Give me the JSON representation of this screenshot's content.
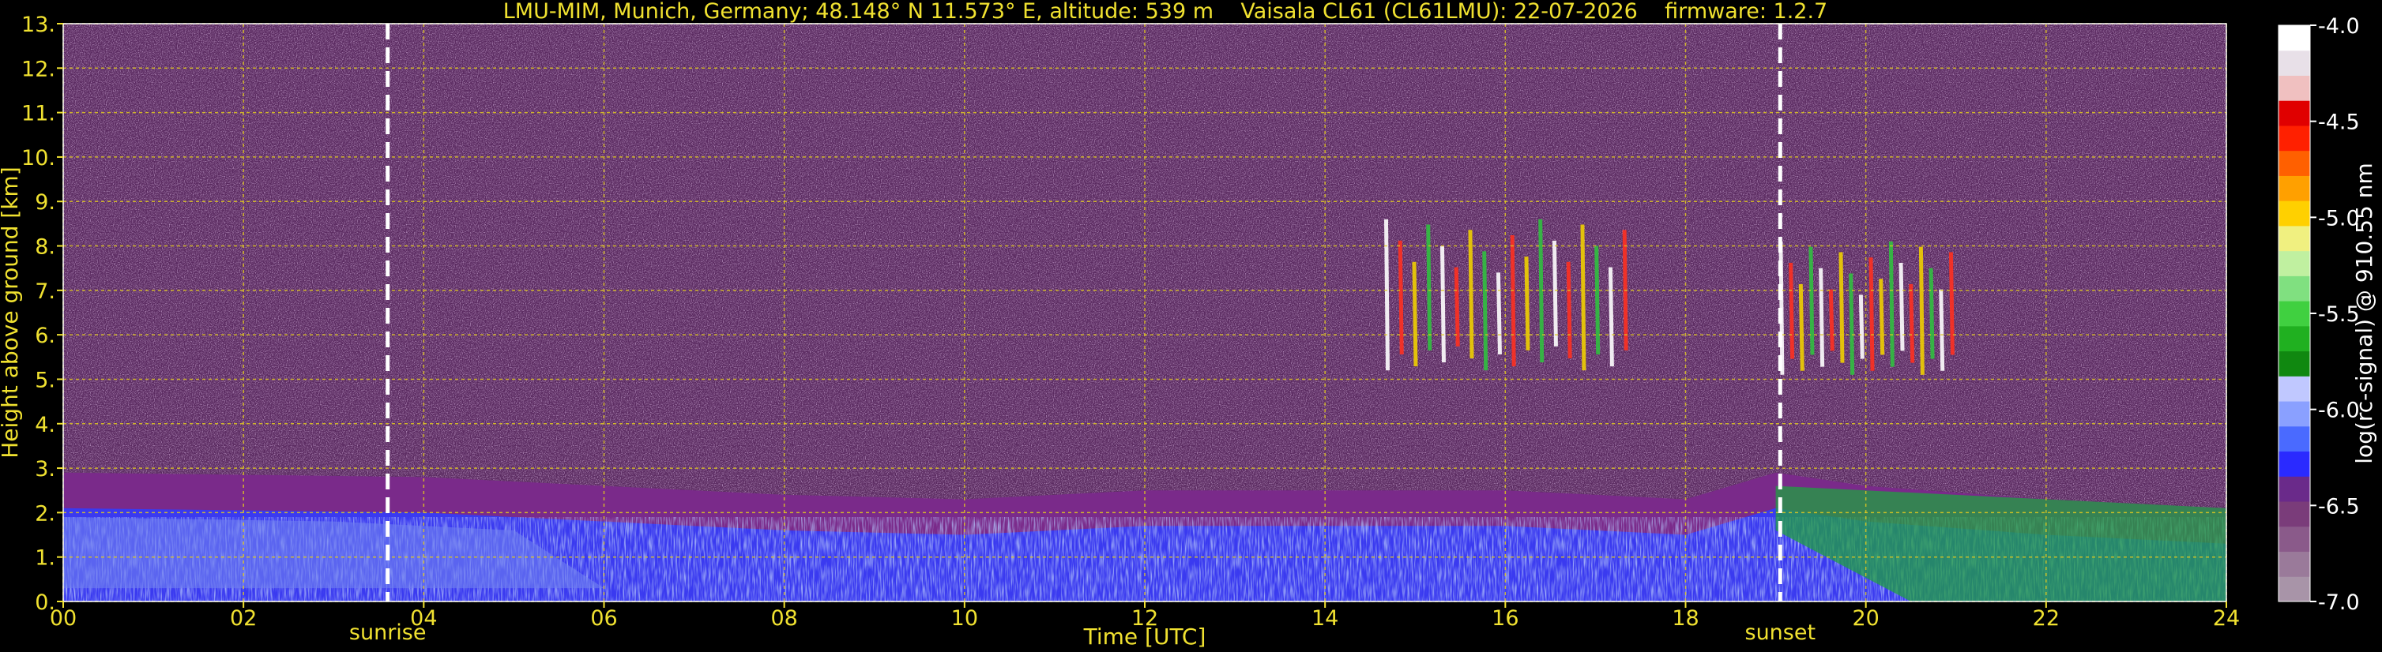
{
  "title": "LMU-MIM, Munich, Germany; 48.148° N 11.573° E, altitude: 539 m    Vaisala CL61 (CL61LMU): 22-07-2026    firmware: 1.2.7",
  "chart_data": {
    "type": "heatmap",
    "xlabel": "Time [UTC]",
    "ylabel": "Height above ground [km]",
    "xlim": [
      0,
      24
    ],
    "ylim": [
      0,
      13
    ],
    "x_ticks": [
      "00",
      "02",
      "04",
      "06",
      "08",
      "10",
      "12",
      "14",
      "16",
      "18",
      "20",
      "22",
      "24"
    ],
    "y_ticks": [
      "0.",
      "1.",
      "2.",
      "3.",
      "4.",
      "5.",
      "6.",
      "7.",
      "8.",
      "9.",
      "10.",
      "11.",
      "12.",
      "13."
    ],
    "grid": true,
    "annotations": [
      {
        "label": "sunrise",
        "x": 3.6
      },
      {
        "label": "sunset",
        "x": 19.05
      }
    ],
    "colorbar": {
      "label": "log(rc-signal) @ 910.55 nm",
      "ticks": [
        "-4.0",
        "-4.5",
        "-5.0",
        "-5.5",
        "-6.0",
        "-6.5",
        "-7.0"
      ],
      "range": [
        -7.0,
        -4.0
      ],
      "colors": [
        "#a894a8",
        "#9a7a9a",
        "#8a5a8a",
        "#7a3c7a",
        "#6a2a8a",
        "#2a2aff",
        "#4a6aff",
        "#8aa0ff",
        "#c0c8ff",
        "#108810",
        "#20b020",
        "#40d040",
        "#80e080",
        "#c0f0a0",
        "#f0f080",
        "#ffd000",
        "#ffa000",
        "#ff6000",
        "#ff2000",
        "#e00000",
        "#f0c0c0",
        "#e8e0e8",
        "#ffffff"
      ]
    },
    "features": {
      "boundary_layer_top_km": [
        [
          0,
          2.9
        ],
        [
          4,
          2.8
        ],
        [
          8,
          2.4
        ],
        [
          10,
          2.3
        ],
        [
          12,
          2.5
        ],
        [
          14,
          2.5
        ],
        [
          16,
          2.5
        ],
        [
          18,
          2.3
        ],
        [
          19,
          2.9
        ],
        [
          20,
          2.6
        ],
        [
          22,
          2.3
        ],
        [
          24,
          2.1
        ]
      ],
      "cirrus": [
        {
          "t0": 14.6,
          "t1": 17.4,
          "base_km": 5.2,
          "top_km": 8.6
        },
        {
          "t0": 19.0,
          "t1": 21.0,
          "base_km": 5.1,
          "top_km": 8.1
        }
      ]
    }
  }
}
